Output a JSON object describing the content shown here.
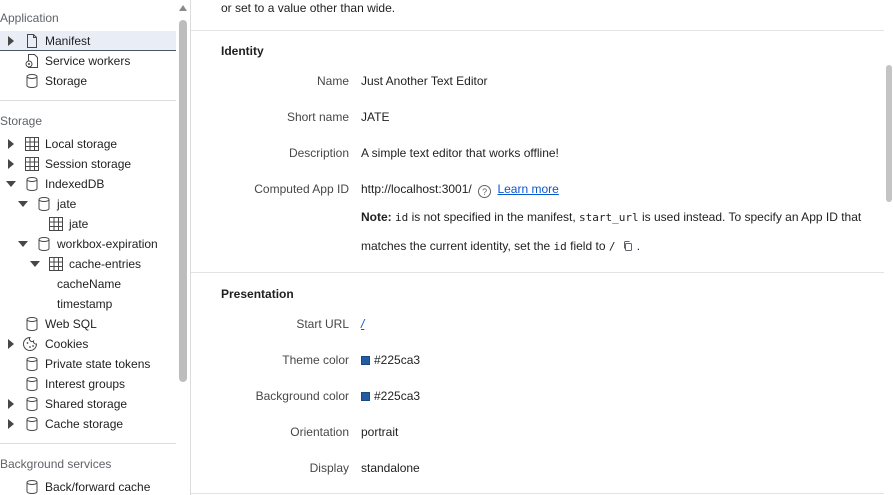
{
  "sidebar": {
    "sections": {
      "application": "Application",
      "storage": "Storage",
      "background": "Background services"
    },
    "items": {
      "manifest": "Manifest",
      "service_workers": "Service workers",
      "app_storage": "Storage",
      "local_storage": "Local storage",
      "session_storage": "Session storage",
      "indexeddb": "IndexedDB",
      "jate_db": "jate",
      "jate_store": "jate",
      "workbox": "workbox-expiration",
      "cache_entries": "cache-entries",
      "cache_name": "cacheName",
      "timestamp": "timestamp",
      "web_sql": "Web SQL",
      "cookies": "Cookies",
      "private_state_tokens": "Private state tokens",
      "interest_groups": "Interest groups",
      "shared_storage": "Shared storage",
      "cache_storage": "Cache storage",
      "bfcache": "Back/forward cache"
    }
  },
  "main": {
    "top_note": "or set to a value other than wide.",
    "identity": {
      "title": "Identity",
      "name_label": "Name",
      "name_value": "Just Another Text Editor",
      "short_name_label": "Short name",
      "short_name_value": "JATE",
      "description_label": "Description",
      "description_value": "A simple text editor that works offline!",
      "app_id_label": "Computed App ID",
      "app_id_value": "http://localhost:3001/",
      "help_glyph": "?",
      "learn_more": "Learn more",
      "note_bold": "Note:",
      "note_code_id": "id",
      "note_part1": " is not specified in the manifest, ",
      "note_code_start": "start_url",
      "note_part2": " is used instead. To specify an App ID that",
      "note_line2_a": "matches the current identity, set the ",
      "note_code_id2": "id",
      "note_line2_b": " field to ",
      "note_code_slash": "/",
      "note_end": "."
    },
    "presentation": {
      "title": "Presentation",
      "start_url_label": "Start URL",
      "start_url_value": "/",
      "theme_color_label": "Theme color",
      "theme_color_value": "#225ca3",
      "bg_color_label": "Background color",
      "bg_color_value": "#225ca3",
      "orientation_label": "Orientation",
      "orientation_value": "portrait",
      "display_label": "Display",
      "display_value": "standalone"
    }
  },
  "colors": {
    "theme_swatch": "#225ca3",
    "link": "#0b57d0",
    "selected_row": "#e9eef6"
  }
}
